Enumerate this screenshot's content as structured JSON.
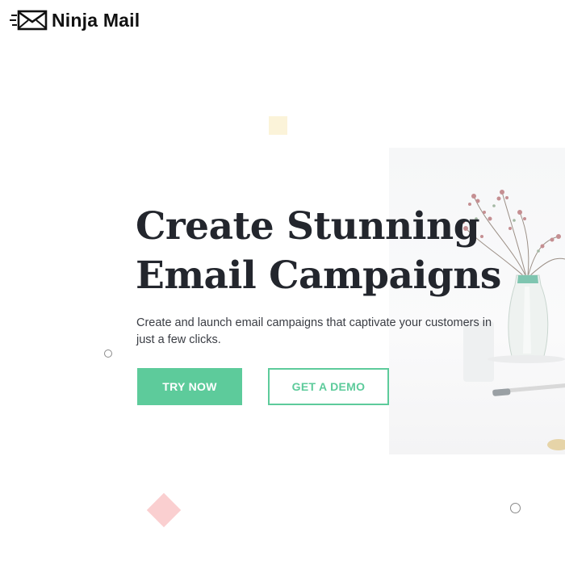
{
  "brand": {
    "name": "Ninja Mail",
    "logo_icon": "envelope-icon"
  },
  "hero": {
    "title_line1": "Create Stunning",
    "title_line2": "Email Campaigns",
    "subtitle": "Create and launch email campaigns that captivate your customers in just a few clicks.",
    "primary_cta": "TRY NOW",
    "secondary_cta": "GET A DEMO"
  },
  "decorations": {
    "square_icon": "yellow-square-decoration",
    "diamond_icon": "pink-diamond-decoration",
    "ring_icon": "small-ring-decoration",
    "image": "vase-with-dried-flowers-photo"
  },
  "colors": {
    "accent": "#5dcb9b",
    "heading": "#23262d",
    "body_text": "#3a3d44",
    "square": "#fbf3d9",
    "diamond": "#f5a7aa"
  }
}
